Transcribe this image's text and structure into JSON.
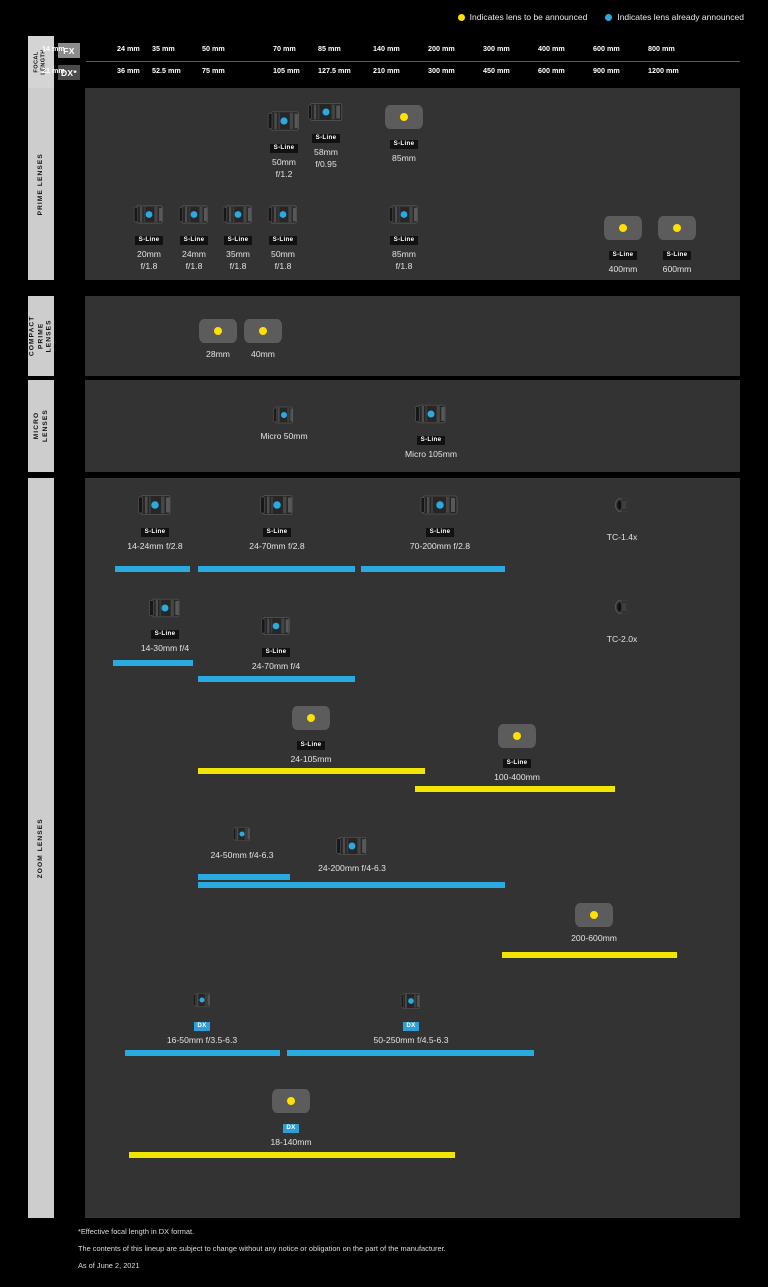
{
  "legend": [
    {
      "color": "#ffe000",
      "label": "Indicates lens to be announced",
      "icon": "yellow-dot-icon"
    },
    {
      "color": "#29abe2",
      "label": "Indicates lens already announced",
      "icon": "blue-dot-icon"
    }
  ],
  "header": {
    "focal_length_label": "FOCAL\nLENGTH",
    "fx_badge": "FX",
    "dx_badge": "DX*",
    "fx_ticks": [
      "14 mm",
      "24 mm",
      "35 mm",
      "50 mm",
      "70 mm",
      "85 mm",
      "140 mm",
      "200 mm",
      "300 mm",
      "400 mm",
      "600 mm",
      "800 mm"
    ],
    "dx_ticks": [
      "21 mm",
      "36 mm",
      "52.5 mm",
      "75 mm",
      "105 mm",
      "127.5 mm",
      "210 mm",
      "300 mm",
      "450 mm",
      "600 mm",
      "900 mm",
      "1200 mm"
    ]
  },
  "sections": [
    {
      "id": "prime",
      "label": "PRIME LENSES"
    },
    {
      "id": "compact-prime",
      "label": "COMPACT\nPRIME\nLENSES"
    },
    {
      "id": "micro",
      "label": "MICRO\nLENSES"
    },
    {
      "id": "zoom",
      "label": "ZOOM LENSES"
    }
  ],
  "prime_lenses": [
    {
      "name": "50mm",
      "aperture": "f/1.2",
      "badge": "S-Line",
      "status": "announced"
    },
    {
      "name": "58mm",
      "aperture": "f/0.95",
      "badge": "S-Line",
      "status": "announced"
    },
    {
      "name": "85mm",
      "aperture": "",
      "badge": "S-Line",
      "status": "to-be-announced"
    },
    {
      "name": "20mm",
      "aperture": "f/1.8",
      "badge": "S-Line",
      "status": "announced"
    },
    {
      "name": "24mm",
      "aperture": "f/1.8",
      "badge": "S-Line",
      "status": "announced"
    },
    {
      "name": "35mm",
      "aperture": "f/1.8",
      "badge": "S-Line",
      "status": "announced"
    },
    {
      "name": "50mm",
      "aperture": "f/1.8",
      "badge": "S-Line",
      "status": "announced"
    },
    {
      "name": "85mm",
      "aperture": "f/1.8",
      "badge": "S-Line",
      "status": "announced"
    },
    {
      "name": "400mm",
      "aperture": "",
      "badge": "S-Line",
      "status": "to-be-announced"
    },
    {
      "name": "600mm",
      "aperture": "",
      "badge": "S-Line",
      "status": "to-be-announced"
    }
  ],
  "compact_prime_lenses": [
    {
      "name": "28mm",
      "badge": "",
      "status": "to-be-announced"
    },
    {
      "name": "40mm",
      "badge": "",
      "status": "to-be-announced"
    }
  ],
  "micro_lenses": [
    {
      "name": "Micro 50mm",
      "badge": "",
      "status": "announced"
    },
    {
      "name": "Micro 105mm",
      "badge": "S-Line",
      "status": "announced"
    }
  ],
  "zoom_lenses": [
    {
      "name": "14-24mm f/2.8",
      "badge": "S-Line",
      "status": "announced",
      "bar": "blue"
    },
    {
      "name": "24-70mm f/2.8",
      "badge": "S-Line",
      "status": "announced",
      "bar": "blue"
    },
    {
      "name": "70-200mm f/2.8",
      "badge": "S-Line",
      "status": "announced",
      "bar": "blue"
    },
    {
      "name": "14-30mm f/4",
      "badge": "S-Line",
      "status": "announced",
      "bar": "blue"
    },
    {
      "name": "24-70mm f/4",
      "badge": "S-Line",
      "status": "announced",
      "bar": "blue"
    },
    {
      "name": "24-105mm",
      "badge": "S-Line",
      "status": "to-be-announced",
      "bar": "yellow"
    },
    {
      "name": "100-400mm",
      "badge": "S-Line",
      "status": "to-be-announced",
      "bar": "yellow"
    },
    {
      "name": "24-50mm f/4-6.3",
      "badge": "",
      "status": "announced",
      "bar": "blue"
    },
    {
      "name": "24-200mm f/4-6.3",
      "badge": "",
      "status": "announced",
      "bar": "blue"
    },
    {
      "name": "200-600mm",
      "badge": "",
      "status": "to-be-announced",
      "bar": "yellow"
    },
    {
      "name": "16-50mm f/3.5-6.3",
      "badge": "DX",
      "status": "announced",
      "bar": "blue"
    },
    {
      "name": "50-250mm f/4.5-6.3",
      "badge": "DX",
      "status": "announced",
      "bar": "blue"
    },
    {
      "name": "18-140mm",
      "badge": "DX",
      "status": "to-be-announced",
      "bar": "yellow"
    }
  ],
  "teleconverters": [
    {
      "name": "TC-1.4x",
      "status": "announced"
    },
    {
      "name": "TC-2.0x",
      "status": "announced"
    }
  ],
  "notes": [
    "*Effective focal length in DX format.",
    "The contents of this lineup are subject to change without any notice or obligation on the part of the manufacturer.",
    "As of June 2, 2021"
  ]
}
